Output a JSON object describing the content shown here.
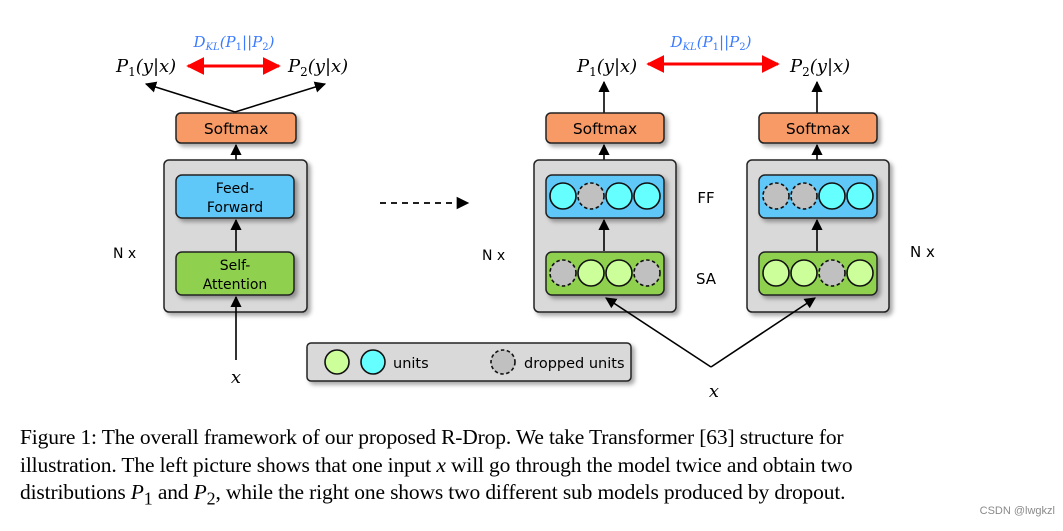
{
  "figure": {
    "left_panel": {
      "kl_label": "D_KL(P_1||P_2)",
      "kl_label_parts": {
        "D": "D",
        "sub": "KL",
        "args": "(P",
        "s1": "1",
        "mid": "||P",
        "s2": "2",
        "close": ")"
      },
      "p1_label": {
        "P": "P",
        "sub": "1",
        "rest": "(y|x)"
      },
      "p2_label": {
        "P": "P",
        "sub": "2",
        "rest": "(y|x)"
      },
      "softmax": "Softmax",
      "ff_line1": "Feed-",
      "ff_line2": "Forward",
      "sa_line1": "Self-",
      "sa_line2": "Attention",
      "n_label": "N x",
      "input": "x"
    },
    "right_panel": {
      "kl_label_parts": {
        "D": "D",
        "sub": "KL",
        "args": "(P",
        "s1": "1",
        "mid": "||P",
        "s2": "2",
        "close": ")"
      },
      "p1_label": {
        "P": "P",
        "sub": "1",
        "rest": "(y|x)"
      },
      "p2_label": {
        "P": "P",
        "sub": "2",
        "rest": "(y|x)"
      },
      "softmax_left": "Softmax",
      "softmax_right": "Softmax",
      "ff_label": "FF",
      "sa_label": "SA",
      "n_label_left": "N x",
      "n_label_right": "N x",
      "input": "x",
      "submodel_1": {
        "ff_units": [
          "active",
          "dropped",
          "active",
          "active"
        ],
        "sa_units": [
          "dropped",
          "active",
          "active",
          "dropped"
        ]
      },
      "submodel_2": {
        "ff_units": [
          "dropped",
          "dropped",
          "active",
          "active"
        ],
        "sa_units": [
          "active",
          "active",
          "dropped",
          "active"
        ]
      }
    },
    "legend": {
      "units_label": "units",
      "dropped_label": "dropped units"
    },
    "colors": {
      "softmax": "#f79a66",
      "ff_block": "#5ec8f8",
      "sa_block": "#8fd14f",
      "ff_unit": "#66ffff",
      "sa_unit": "#ccff99",
      "dropped_unit": "#c0c0c0",
      "container": "#d9d9d9",
      "kl_arrow": "#ff0000",
      "kl_text": "#3b7bff"
    }
  },
  "caption": {
    "line1": "Figure 1: The overall framework of our proposed R-Drop. We take Transformer [63] structure for",
    "line2_a": "illustration. The left picture shows that one input ",
    "line2_x": "x",
    "line2_b": " will go through the model twice and obtain two",
    "line3_a": "distributions ",
    "line3_p1": "P",
    "line3_s1": "1",
    "line3_b": " and ",
    "line3_p2": "P",
    "line3_s2": "2",
    "line3_c": ", while the right one shows two different sub models produced by dropout."
  },
  "watermark": "CSDN @lwgkzl"
}
